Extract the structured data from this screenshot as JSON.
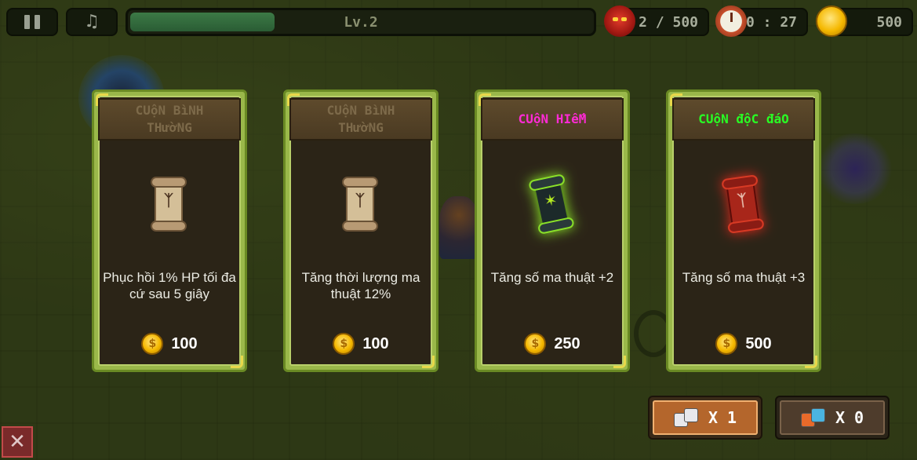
{
  "hud": {
    "pause_icon": "pause-icon",
    "music_icon": "music-note-icon",
    "level": "Lv.2",
    "level_progress": 0.31,
    "kill_count": "2 / 500",
    "timer": "00 : 27",
    "gold": "500"
  },
  "cards": [
    {
      "rarity": "common",
      "title": "CUộN BìNH THườNG",
      "icon": "scroll-icon",
      "description": "Phục hồi 1% HP tối đa cứ sau 5 giây",
      "price": "100",
      "rune": "ᛉ"
    },
    {
      "rarity": "common",
      "title": "CUộN BìNH THườNG",
      "icon": "scroll-icon",
      "description": "Tăng thời lượng ma thuật 12%",
      "price": "100",
      "rune": "ᛉ"
    },
    {
      "rarity": "rare",
      "title": "CUộN HIếM",
      "icon": "rare-scroll-icon",
      "description": "Tăng số ma thuật +2",
      "price": "250",
      "rune": "✶"
    },
    {
      "rarity": "unique",
      "title": "CUộN độC đáO",
      "icon": "unique-scroll-icon",
      "description": "Tăng số ma thuật +3",
      "price": "500",
      "rune": "ᛉ"
    }
  ],
  "bottom": {
    "reroll_count": "X 1",
    "magic_dice_count": "X 0",
    "close_glyph": "✕"
  },
  "colors": {
    "rare_title": "#ff2ad6",
    "unique_title": "#28ff24",
    "common_title": "#7d6a4a",
    "card_frame": "#9ab84a"
  }
}
